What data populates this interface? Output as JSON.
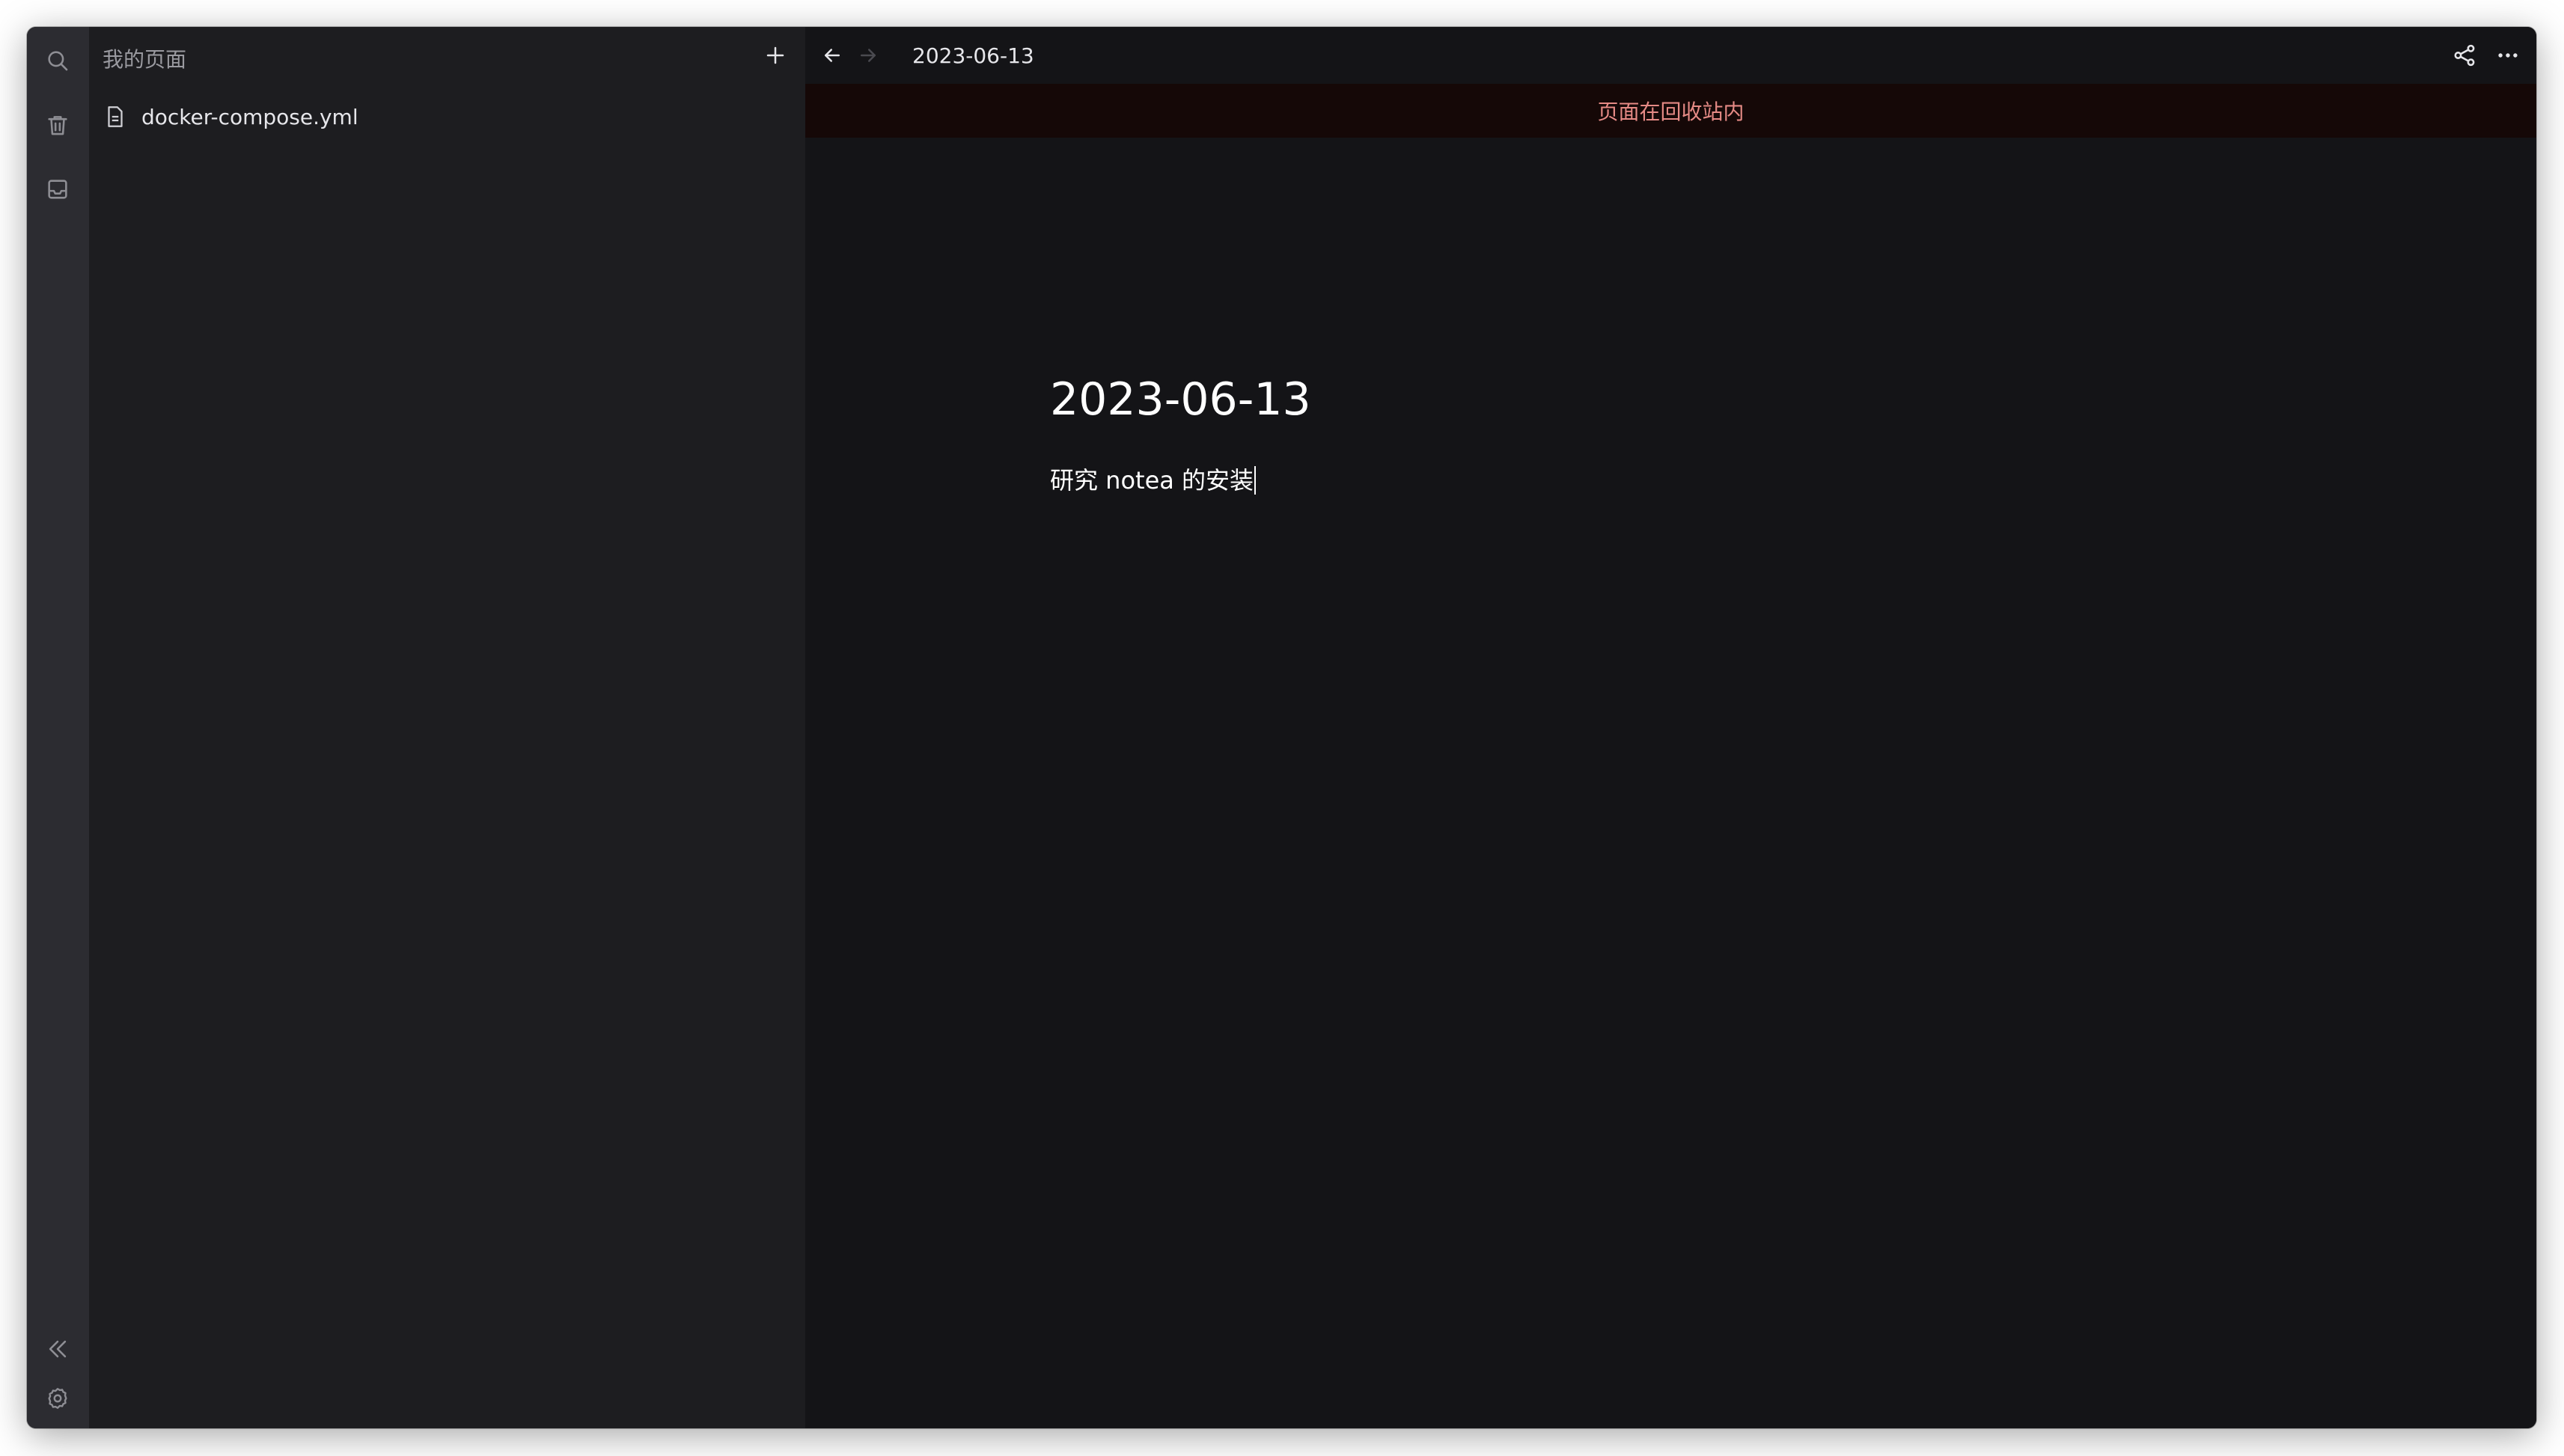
{
  "sidebar": {
    "title": "我的页面",
    "files": [
      {
        "label": "docker-compose.yml"
      }
    ]
  },
  "rail": {
    "top_icons": [
      "search-icon",
      "trash-icon",
      "inbox-icon"
    ],
    "bottom_icons": [
      "collapse-sidebar-icon",
      "settings-icon"
    ]
  },
  "topbar": {
    "breadcrumb": "2023-06-13"
  },
  "banner": {
    "text": "页面在回收站内"
  },
  "document": {
    "title": "2023-06-13",
    "body": "研究 notea 的安装"
  },
  "colors": {
    "rail_bg": "#2c2c31",
    "sidebar_bg": "#1d1d20",
    "main_bg": "#141417",
    "banner_bg": "#150807",
    "banner_text": "#e58a85"
  }
}
